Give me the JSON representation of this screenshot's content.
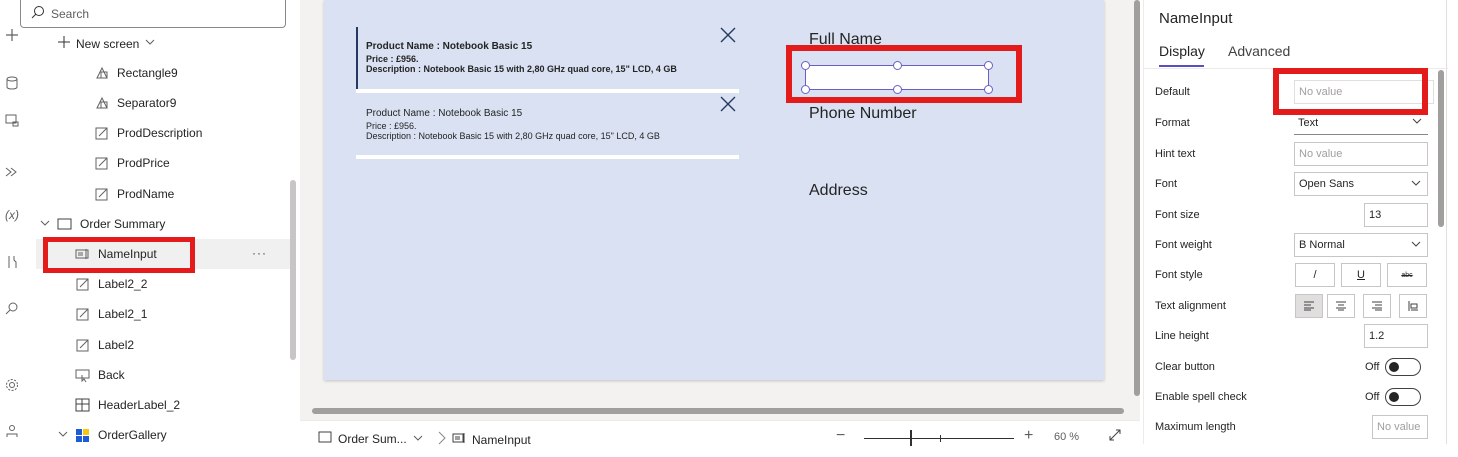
{
  "rail": {
    "icons": [
      "plus-icon",
      "database-icon",
      "media-icon",
      "power-automate-icon",
      "variables-icon",
      "tools-icon",
      "search-icon",
      "settings-icon",
      "virtual-agent-icon"
    ]
  },
  "tree": {
    "search_placeholder": "Search",
    "new_screen_label": "New screen",
    "items": [
      {
        "label": "Rectangle9",
        "icon": "shape-icon"
      },
      {
        "label": "Separator9",
        "icon": "shape-icon"
      },
      {
        "label": "ProdDescription",
        "icon": "label-icon"
      },
      {
        "label": "ProdPrice",
        "icon": "label-icon"
      },
      {
        "label": "ProdName",
        "icon": "label-icon"
      },
      {
        "label": "Order Summary",
        "icon": "screen-icon"
      },
      {
        "label": "NameInput",
        "icon": "text-input-icon"
      },
      {
        "label": "Label2_2",
        "icon": "label-icon"
      },
      {
        "label": "Label2_1",
        "icon": "label-icon"
      },
      {
        "label": "Label2",
        "icon": "label-icon"
      },
      {
        "label": "Back",
        "icon": "button-icon"
      },
      {
        "label": "HeaderLabel_2",
        "icon": "header-icon"
      },
      {
        "label": "OrderGallery",
        "icon": "gallery-icon"
      }
    ],
    "selected": "NameInput",
    "more_label": "···"
  },
  "canvas": {
    "products": [
      {
        "name": "Product Name :  Notebook Basic 15",
        "price": "Price :  £956.",
        "description": "Description  :  Notebook Basic 15 with 2,80 GHz quad core, 15\" LCD, 4 GB"
      },
      {
        "name": "Product Name :  Notebook Basic 15",
        "price": "Price :  £956.",
        "description": "Description  :  Notebook Basic 15 with 2,80 GHz quad core, 15\" LCD, 4 GB"
      }
    ],
    "labels": {
      "full_name": "Full Name",
      "phone": "Phone Number",
      "address": "Address"
    }
  },
  "statusbar": {
    "screen_crumb": "Order Sum...",
    "control_crumb": "NameInput",
    "zoom": "60  %"
  },
  "props": {
    "title": "NameInput",
    "tabs": [
      "Display",
      "Advanced"
    ],
    "active_tab": "Display",
    "rows": {
      "default": {
        "label": "Default",
        "value": "No value"
      },
      "format": {
        "label": "Format",
        "value": "Text"
      },
      "hint": {
        "label": "Hint text",
        "value": "No value"
      },
      "font": {
        "label": "Font",
        "value": "Open Sans"
      },
      "font_size": {
        "label": "Font size",
        "value": "13"
      },
      "font_weight": {
        "label": "Font weight",
        "value": "B  Normal"
      },
      "font_style": {
        "label": "Font style",
        "italic": "/",
        "underline": "U",
        "strike": "abc"
      },
      "text_align": {
        "label": "Text alignment"
      },
      "line_height": {
        "label": "Line height",
        "value": "1.2"
      },
      "clear_button": {
        "label": "Clear button",
        "value": "Off"
      },
      "spell_check": {
        "label": "Enable spell check",
        "value": "Off"
      },
      "max_length": {
        "label": "Maximum length",
        "value": "No value"
      }
    }
  },
  "colors": {
    "highlight": "#e31b1b",
    "accent": "#5b4fbd",
    "canvas_screen": "#d9e1f2"
  }
}
